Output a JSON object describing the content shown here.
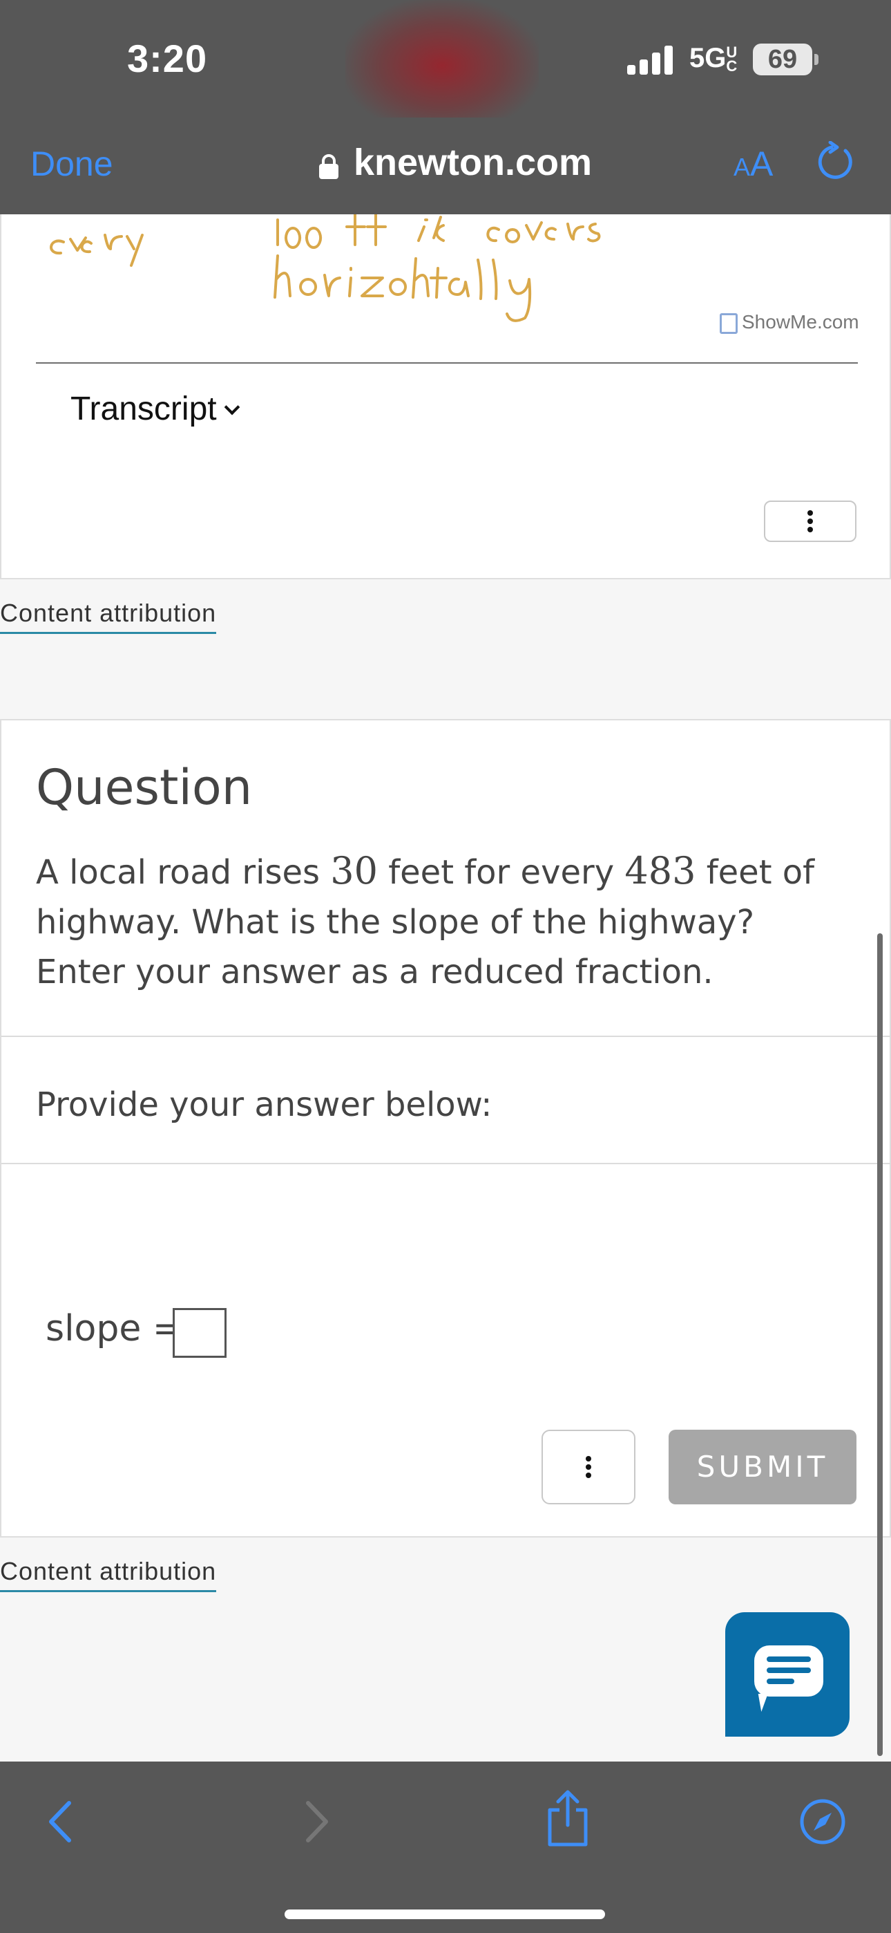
{
  "status_bar": {
    "time": "3:20",
    "network": "5G",
    "network_suffix": "UC",
    "battery": "69"
  },
  "browser": {
    "done_label": "Done",
    "url": "knewton.com",
    "text_size_small": "A",
    "text_size_large": "A",
    "accent_color": "#3e8ef7"
  },
  "video_card": {
    "watermark": "ShowMe.com",
    "transcript_label": "Transcript",
    "handwriting": [
      "every",
      "100 ft it covers",
      "horizontally"
    ]
  },
  "attribution_1": "Content attribution",
  "question": {
    "title": "Question",
    "text_part1": "A local road rises ",
    "rise": "30",
    "text_part2": " feet for every ",
    "run": "483",
    "text_part3": " feet of highway. What is the slope of the highway? Enter your answer as a reduced fraction.",
    "provide_label": "Provide your answer below:",
    "slope_label": "slope =",
    "slope_value": "",
    "submit_label": "SUBMIT"
  },
  "attribution_2": "Content attribution",
  "colors": {
    "chrome_gray": "#575757",
    "link_teal": "#2b8aa6",
    "chat_blue": "#0a6ea8",
    "submit_gray": "#a7a7a7"
  },
  "icons": [
    "lock-icon",
    "reload-icon",
    "chevron-down-icon",
    "more-options-icon",
    "chat-icon",
    "back-icon",
    "forward-icon",
    "share-icon",
    "compass-icon"
  ]
}
